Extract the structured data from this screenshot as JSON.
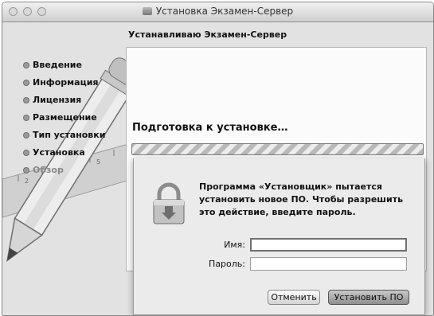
{
  "window": {
    "title": "Установка Экзамен-Сервер",
    "subtitle": "Устанавливаю Экзамен-Сервер"
  },
  "sidebar": {
    "steps": [
      {
        "label": "Введение"
      },
      {
        "label": "Информация"
      },
      {
        "label": "Лицензия"
      },
      {
        "label": "Размещение"
      },
      {
        "label": "Тип установки"
      },
      {
        "label": "Установка"
      },
      {
        "label": "Обзор"
      }
    ]
  },
  "main": {
    "status": "Подготовка к установке…",
    "progress_state": "indeterminate"
  },
  "ruler": {
    "ticks": [
      "2",
      "3",
      "4",
      "5"
    ]
  },
  "auth_dialog": {
    "message": "Программа «Установщик» пытается установить новое ПО. Чтобы разрешить это действие, введите пароль.",
    "name_label": "Имя:",
    "name_value": "",
    "password_label": "Пароль:",
    "password_value": "",
    "cancel_label": "Отменить",
    "install_label": "Установить ПО"
  }
}
